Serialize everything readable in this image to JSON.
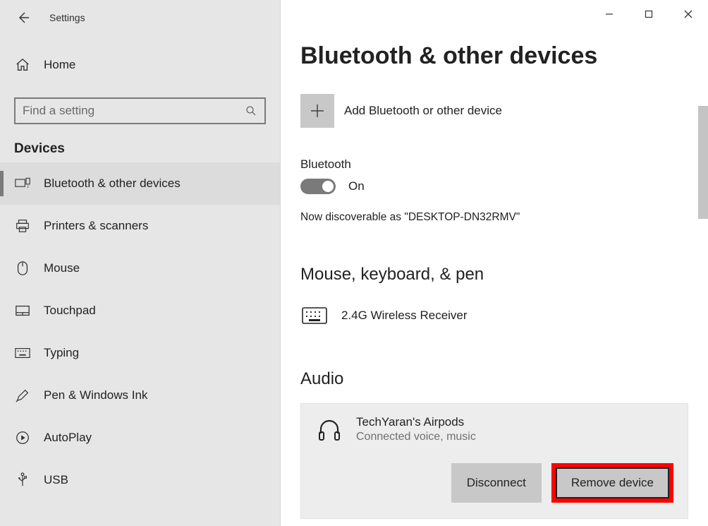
{
  "header": {
    "title": "Settings"
  },
  "sidebar": {
    "home_label": "Home",
    "search_placeholder": "Find a setting",
    "category_label": "Devices",
    "items": [
      {
        "label": "Bluetooth & other devices",
        "icon": "devices-icon",
        "selected": true
      },
      {
        "label": "Printers & scanners",
        "icon": "printer-icon"
      },
      {
        "label": "Mouse",
        "icon": "mouse-icon"
      },
      {
        "label": "Touchpad",
        "icon": "touchpad-icon"
      },
      {
        "label": "Typing",
        "icon": "keyboard-icon"
      },
      {
        "label": "Pen & Windows Ink",
        "icon": "pen-icon"
      },
      {
        "label": "AutoPlay",
        "icon": "autoplay-icon"
      },
      {
        "label": "USB",
        "icon": "usb-icon"
      }
    ]
  },
  "main": {
    "page_title": "Bluetooth & other devices",
    "add_device_label": "Add Bluetooth or other device",
    "bluetooth_label": "Bluetooth",
    "toggle_state": "On",
    "discover_text": "Now discoverable as \"DESKTOP-DN32RMV\"",
    "section_mouse": "Mouse, keyboard, & pen",
    "mouse_device": "2.4G Wireless Receiver",
    "section_audio": "Audio",
    "audio_device": {
      "name": "TechYaran's Airpods",
      "status": "Connected voice, music"
    },
    "disconnect_label": "Disconnect",
    "remove_label": "Remove device"
  }
}
